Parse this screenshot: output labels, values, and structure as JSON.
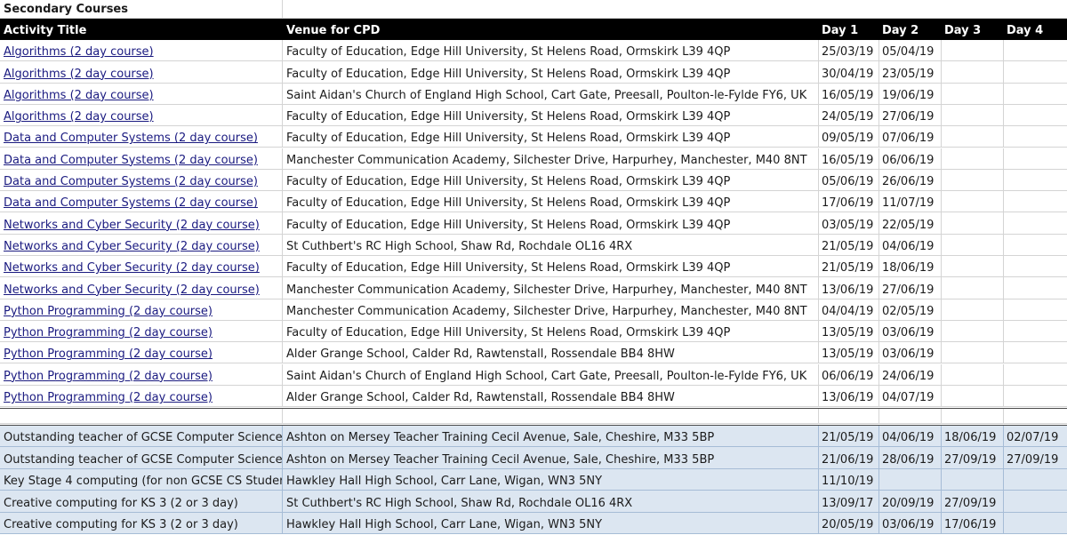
{
  "sheet": {
    "section_title": "Secondary Courses"
  },
  "headers": {
    "activity": "Activity Title",
    "venue": "Venue for CPD",
    "day1": "Day 1",
    "day2": "Day 2",
    "day3": "Day 3",
    "day4": "Day 4"
  },
  "courses": [
    {
      "activity": "Algorithms (2 day course)",
      "venue": "Faculty of Education, Edge Hill University, St Helens Road, Ormskirk L39 4QP",
      "day1": "25/03/19",
      "day2": "05/04/19",
      "day3": "",
      "day4": ""
    },
    {
      "activity": "Algorithms (2 day course)",
      "venue": "Faculty of Education, Edge Hill University, St Helens Road, Ormskirk L39 4QP",
      "day1": "30/04/19",
      "day2": "23/05/19",
      "day3": "",
      "day4": ""
    },
    {
      "activity": "Algorithms (2 day course)",
      "venue": "Saint Aidan's Church of England High School, Cart Gate, Preesall, Poulton-le-Fylde FY6, UK",
      "day1": "16/05/19",
      "day2": "19/06/19",
      "day3": "",
      "day4": ""
    },
    {
      "activity": "Algorithms (2 day course)",
      "venue": "Faculty of Education, Edge Hill University, St Helens Road, Ormskirk L39 4QP",
      "day1": "24/05/19",
      "day2": "27/06/19",
      "day3": "",
      "day4": ""
    },
    {
      "activity": "Data and Computer Systems (2 day course)",
      "venue": "Faculty of Education, Edge Hill University, St Helens Road, Ormskirk L39 4QP",
      "day1": "09/05/19",
      "day2": "07/06/19",
      "day3": "",
      "day4": ""
    },
    {
      "activity": "Data and Computer Systems (2 day course)",
      "venue": "Manchester Communication Academy, Silchester Drive, Harpurhey, Manchester, M40 8NT",
      "day1": "16/05/19",
      "day2": "06/06/19",
      "day3": "",
      "day4": ""
    },
    {
      "activity": "Data and Computer Systems (2 day course)",
      "venue": "Faculty of Education, Edge Hill University, St Helens Road, Ormskirk L39 4QP",
      "day1": "05/06/19",
      "day2": "26/06/19",
      "day3": "",
      "day4": ""
    },
    {
      "activity": "Data and Computer Systems (2 day course)",
      "venue": "Faculty of Education, Edge Hill University, St Helens Road, Ormskirk L39 4QP",
      "day1": "17/06/19",
      "day2": "11/07/19",
      "day3": "",
      "day4": ""
    },
    {
      "activity": "Networks and Cyber Security (2 day course)",
      "venue": "Faculty of Education, Edge Hill University, St Helens Road, Ormskirk L39 4QP",
      "day1": "03/05/19",
      "day2": "22/05/19",
      "day3": "",
      "day4": ""
    },
    {
      "activity": "Networks and Cyber Security (2 day course)",
      "venue": "St Cuthbert's RC High School, Shaw Rd, Rochdale OL16 4RX",
      "day1": "21/05/19",
      "day2": "04/06/19",
      "day3": "",
      "day4": ""
    },
    {
      "activity": "Networks and Cyber Security (2 day course)",
      "venue": "Faculty of Education, Edge Hill University, St Helens Road, Ormskirk L39 4QP",
      "day1": "21/05/19",
      "day2": "18/06/19",
      "day3": "",
      "day4": ""
    },
    {
      "activity": "Networks and Cyber Security (2 day course)",
      "venue": "Manchester Communication Academy, Silchester Drive, Harpurhey, Manchester, M40 8NT",
      "day1": "13/06/19",
      "day2": "27/06/19",
      "day3": "",
      "day4": ""
    },
    {
      "activity": "Python Programming (2 day course)",
      "venue": "Manchester Communication Academy, Silchester Drive, Harpurhey, Manchester, M40 8NT",
      "day1": "04/04/19",
      "day2": "02/05/19",
      "day3": "",
      "day4": ""
    },
    {
      "activity": "Python Programming (2 day course)",
      "venue": "Faculty of Education, Edge Hill University, St Helens Road, Ormskirk L39 4QP",
      "day1": "13/05/19",
      "day2": "03/06/19",
      "day3": "",
      "day4": ""
    },
    {
      "activity": "Python Programming (2 day course)",
      "venue": "Alder Grange School, Calder Rd, Rawtenstall, Rossendale BB4 8HW",
      "day1": "13/05/19",
      "day2": "03/06/19",
      "day3": "",
      "day4": ""
    },
    {
      "activity": "Python Programming (2 day course)",
      "venue": "Saint Aidan's Church of England High School, Cart Gate, Preesall, Poulton-le-Fylde FY6, UK",
      "day1": "06/06/19",
      "day2": "24/06/19",
      "day3": "",
      "day4": ""
    },
    {
      "activity": "Python Programming (2 day course)",
      "venue": "Alder Grange School, Calder Rd, Rawtenstall, Rossendale BB4 8HW",
      "day1": "13/06/19",
      "day2": "04/07/19",
      "day3": "",
      "day4": ""
    }
  ],
  "extra_courses": [
    {
      "activity": "Outstanding teacher of GCSE Computer Science",
      "venue": "Ashton on Mersey Teacher Training Cecil Avenue, Sale, Cheshire, M33 5BP",
      "day1": "21/05/19",
      "day2": "04/06/19",
      "day3": "18/06/19",
      "day4": "02/07/19"
    },
    {
      "activity": "Outstanding teacher of GCSE Computer Science",
      "venue": "Ashton on Mersey Teacher Training Cecil Avenue, Sale, Cheshire, M33 5BP",
      "day1": "21/06/19",
      "day2": "28/06/19",
      "day3": "27/09/19",
      "day4": "27/09/19"
    },
    {
      "activity": "Key Stage 4 computing (for non GCSE CS Studer",
      "venue": "Hawkley Hall High School, Carr Lane, Wigan, WN3 5NY",
      "day1": "11/10/19",
      "day2": "",
      "day3": "",
      "day4": ""
    },
    {
      "activity": "Creative computing for KS 3 (2 or 3 day)",
      "venue": "St Cuthbert's RC High School, Shaw Rd, Rochdale OL16 4RX",
      "day1": "13/09/17",
      "day2": "20/09/19",
      "day3": "27/09/19",
      "day4": ""
    },
    {
      "activity": "Creative computing for KS 3 (2 or 3 day)",
      "venue": "Hawkley Hall High School, Carr Lane, Wigan, WN3 5NY",
      "day1": "20/05/19",
      "day2": "03/06/19",
      "day3": "17/06/19",
      "day4": ""
    }
  ],
  "colors": {
    "header_bg": "#000000",
    "header_text": "#ffffff",
    "link": "#1a1a80",
    "highlight_bg": "#dce6f1"
  }
}
